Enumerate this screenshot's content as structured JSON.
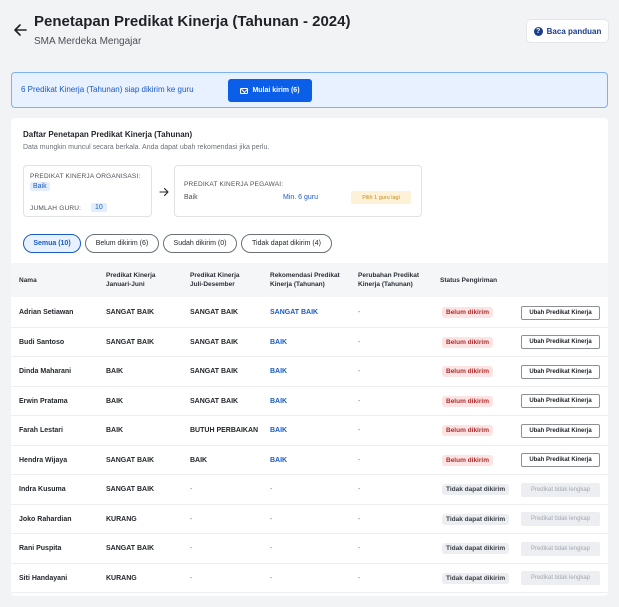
{
  "header": {
    "title": "Penetapan Predikat Kinerja (Tahunan - 2024)",
    "subtitle": "SMA Merdeka Mengajar",
    "guide_button": "Baca panduan"
  },
  "banner": {
    "text": "6 Predikat Kinerja (Tahunan) siap dikirim ke guru",
    "send_button": "Mulai kirim (6)"
  },
  "summary": {
    "title": "Daftar Penetapan Predikat Kinerja (Tahunan)",
    "description": "Data mungkin muncul secara berkala. Anda dapat ubah rekomendasi jika perlu.",
    "org_label": "PREDIKAT KINERJA ORGANISASI:",
    "org_value": "Baik",
    "teacher_count_label": "JUMLAH GURU:",
    "teacher_count_value": "10",
    "employee_label": "PREDIKAT KINERJA PEGAWAI:",
    "employee_value": "Baik",
    "employee_min": "Min. 6 guru",
    "employee_hint": "Pilih 1 guru lagi"
  },
  "tabs": [
    {
      "label": "Semua (10)",
      "active": true
    },
    {
      "label": "Belum dikirim (6)",
      "active": false
    },
    {
      "label": "Sudah dikirim (0)",
      "active": false
    },
    {
      "label": "Tidak dapat dikirim (4)",
      "active": false
    }
  ],
  "table": {
    "columns": [
      "Nama",
      "Predikat Kinerja\nJanuari-Juni",
      "Predikat Kinerja\nJuli-Desember",
      "Rekomendasi Predikat\nKinerja (Tahunan)",
      "Perubahan Predikat\nKinerja (Tahunan)",
      "Status Pengiriman"
    ],
    "rows": [
      {
        "name": "Adrian Setiawan",
        "jan_jun": "SANGAT BAIK",
        "jul_dec": "SANGAT BAIK",
        "recommendation": "SANGAT BAIK",
        "change": "-",
        "status": "Belum dikirim",
        "status_type": "pending",
        "action": "Ubah Predikat Kinerja",
        "action_enabled": true
      },
      {
        "name": "Budi Santoso",
        "jan_jun": "SANGAT BAIK",
        "jul_dec": "SANGAT BAIK",
        "recommendation": "BAIK",
        "change": "-",
        "status": "Belum dikirim",
        "status_type": "pending",
        "action": "Ubah Predikat Kinerja",
        "action_enabled": true
      },
      {
        "name": "Dinda Maharani",
        "jan_jun": "BAIK",
        "jul_dec": "SANGAT BAIK",
        "recommendation": "BAIK",
        "change": "-",
        "status": "Belum dikirim",
        "status_type": "pending",
        "action": "Ubah Predikat Kinerja",
        "action_enabled": true
      },
      {
        "name": "Erwin Pratama",
        "jan_jun": "BAIK",
        "jul_dec": "SANGAT BAIK",
        "recommendation": "BAIK",
        "change": "-",
        "status": "Belum dikirim",
        "status_type": "pending",
        "action": "Ubah Predikat Kinerja",
        "action_enabled": true
      },
      {
        "name": "Farah Lestari",
        "jan_jun": "BAIK",
        "jul_dec": "BUTUH PERBAIKAN",
        "recommendation": "BAIK",
        "change": "-",
        "status": "Belum dikirim",
        "status_type": "pending",
        "action": "Ubah Predikat Kinerja",
        "action_enabled": true
      },
      {
        "name": "Hendra Wijaya",
        "jan_jun": "SANGAT BAIK",
        "jul_dec": "BAIK",
        "recommendation": "BAIK",
        "change": "-",
        "status": "Belum dikirim",
        "status_type": "pending",
        "action": "Ubah Predikat Kinerja",
        "action_enabled": true
      },
      {
        "name": "Indra Kusuma",
        "jan_jun": "SANGAT BAIK",
        "jul_dec": "-",
        "recommendation": "-",
        "change": "-",
        "status": "Tidak dapat dikirim",
        "status_type": "blocked",
        "action": "Predikat tidak lengkap",
        "action_enabled": false
      },
      {
        "name": "Joko Rahardian",
        "jan_jun": "KURANG",
        "jul_dec": "-",
        "recommendation": "-",
        "change": "-",
        "status": "Tidak dapat dikirim",
        "status_type": "blocked",
        "action": "Predikat tidak lengkap",
        "action_enabled": false
      },
      {
        "name": "Rani Puspita",
        "jan_jun": "SANGAT BAIK",
        "jul_dec": "-",
        "recommendation": "-",
        "change": "-",
        "status": "Tidak dapat dikirim",
        "status_type": "blocked",
        "action": "Predikat tidak lengkap",
        "action_enabled": false
      },
      {
        "name": "Siti Handayani",
        "jan_jun": "KURANG",
        "jul_dec": "-",
        "recommendation": "-",
        "change": "-",
        "status": "Tidak dapat dikirim",
        "status_type": "blocked",
        "action": "Predikat tidak lengkap",
        "action_enabled": false
      }
    ]
  }
}
